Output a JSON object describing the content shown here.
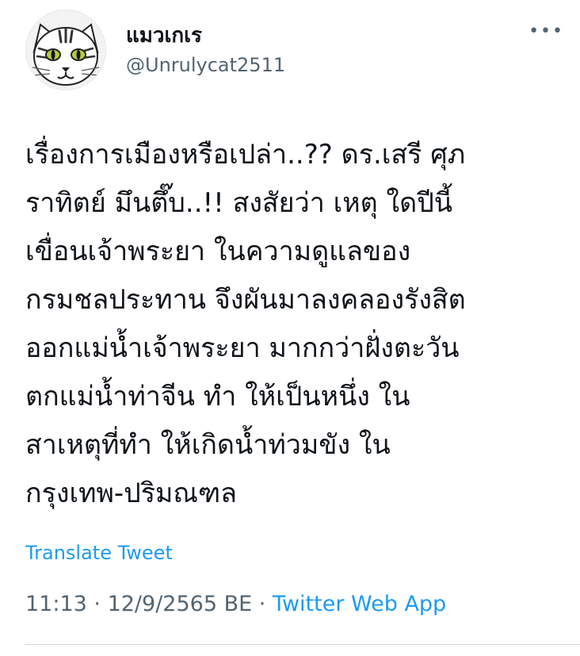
{
  "author": {
    "display_name": "แมวเกเร",
    "handle": "@Unrulycat2511",
    "avatar_icon": "cat-face-icon"
  },
  "more_icon": "more-options-icon",
  "tweet": {
    "text": "เรื่องการเมืองหรือเปล่า..?? ดร.เสรี ศุภ\nราทิตย์ มึนตึ๊บ..!! สงสัยว่า เหตุ ใดปีนี้\nเขื่อนเจ้าพระยา ในความดูแลของ\nกรมชลประทาน จึงผันมาลงคลองรังสิต\nออกแม่น้ำเจ้าพระยา มากกว่าฝั่งตะวัน\nตกแม่น้ำท่าจีน ทำ ให้เป็นหนึ่ง ใน\nสาเหตุที่ทำ ให้เกิดน้ำท่วมขัง ใน\nกรุงเทพ-ปริมณฑล"
  },
  "translate_label": "Translate Tweet",
  "meta": {
    "time": "11:13",
    "date": "12/9/2565 BE",
    "separator": " · ",
    "source": "Twitter Web App"
  },
  "colors": {
    "link": "#1d9bf0",
    "secondary_text": "#536471",
    "primary_text": "#0f1419"
  }
}
